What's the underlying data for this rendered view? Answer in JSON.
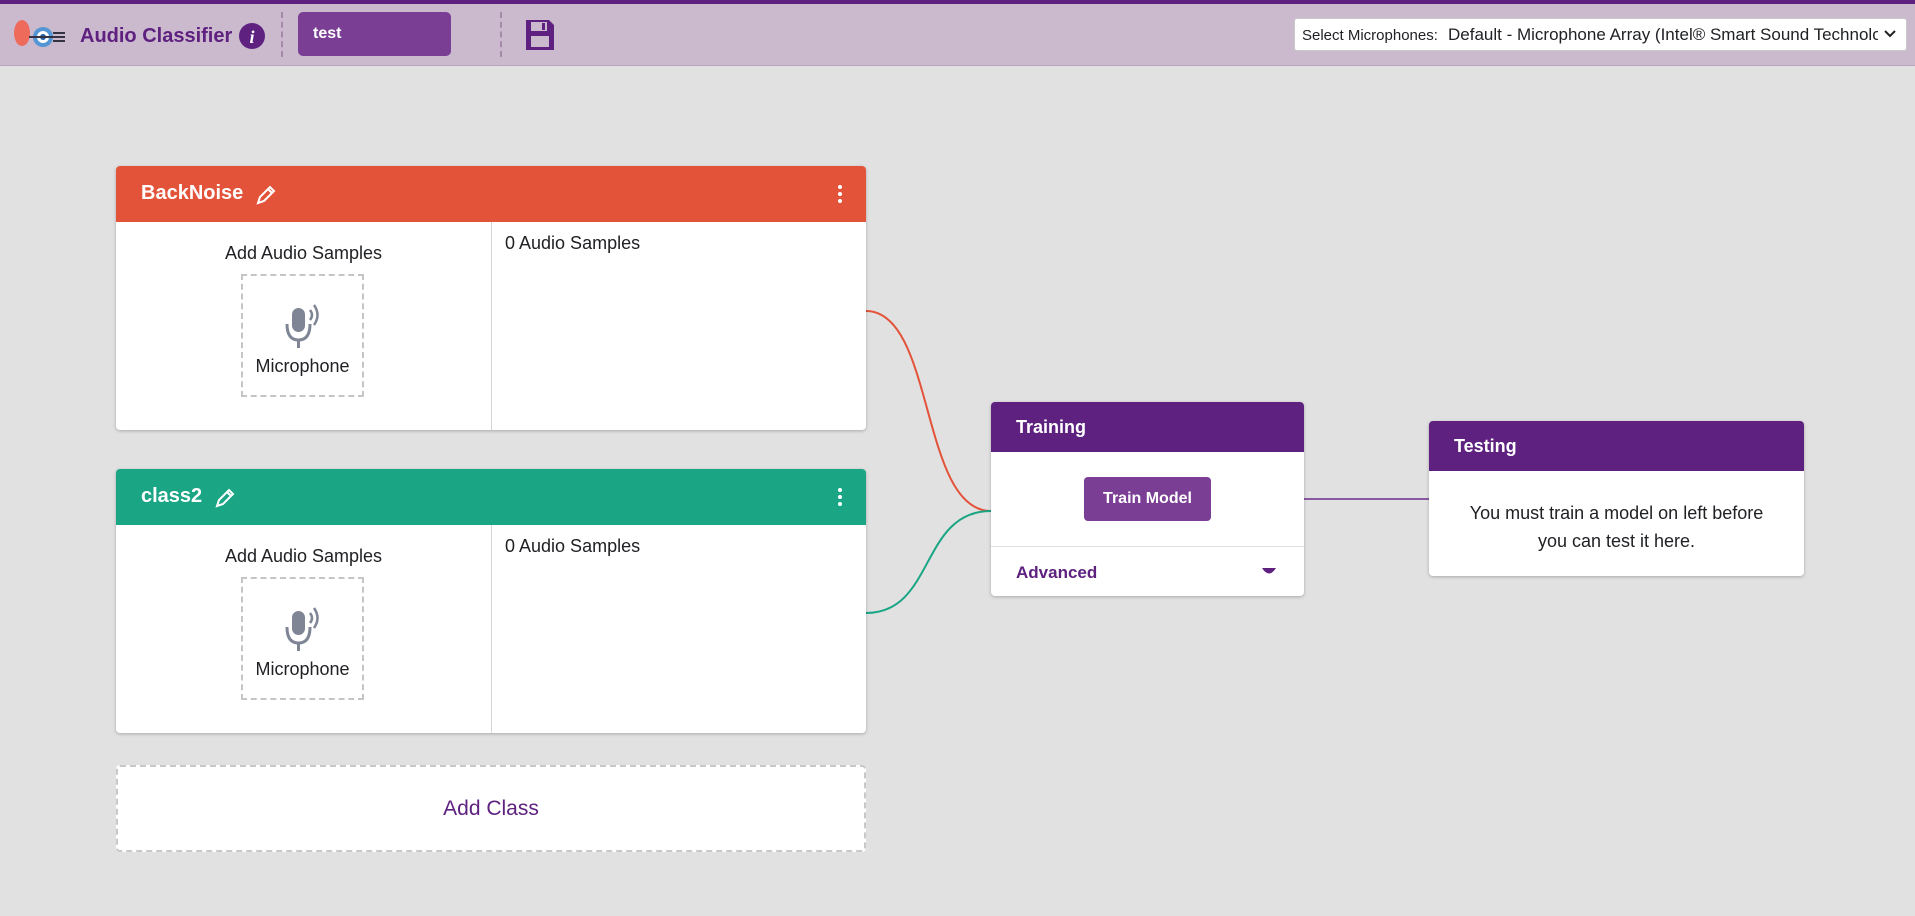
{
  "app": {
    "title": "Audio Classifier",
    "accent_color": "#5e2180",
    "header_bg": "#cbb9ce",
    "icons": [
      "logo",
      "info-icon",
      "save-icon",
      "chevron-down-icon"
    ]
  },
  "project": {
    "name": "test"
  },
  "microphone_select": {
    "label": "Select Microphones:",
    "selected": "Default - Microphone Array (Intel® Smart Sound Technolog"
  },
  "classes": [
    {
      "name": "BackNoise",
      "color": "#e2533a",
      "add_samples_label": "Add Audio Samples",
      "mic_button_label": "Microphone",
      "sample_count_text": "0 Audio Samples"
    },
    {
      "name": "class2",
      "color": "#1aa585",
      "add_samples_label": "Add Audio Samples",
      "mic_button_label": "Microphone",
      "sample_count_text": "0 Audio Samples"
    }
  ],
  "add_class": {
    "label": "Add Class"
  },
  "training": {
    "title": "Training",
    "train_button_label": "Train Model",
    "advanced_label": "Advanced"
  },
  "testing": {
    "title": "Testing",
    "message": "You must train a model on left before you can test it here."
  }
}
